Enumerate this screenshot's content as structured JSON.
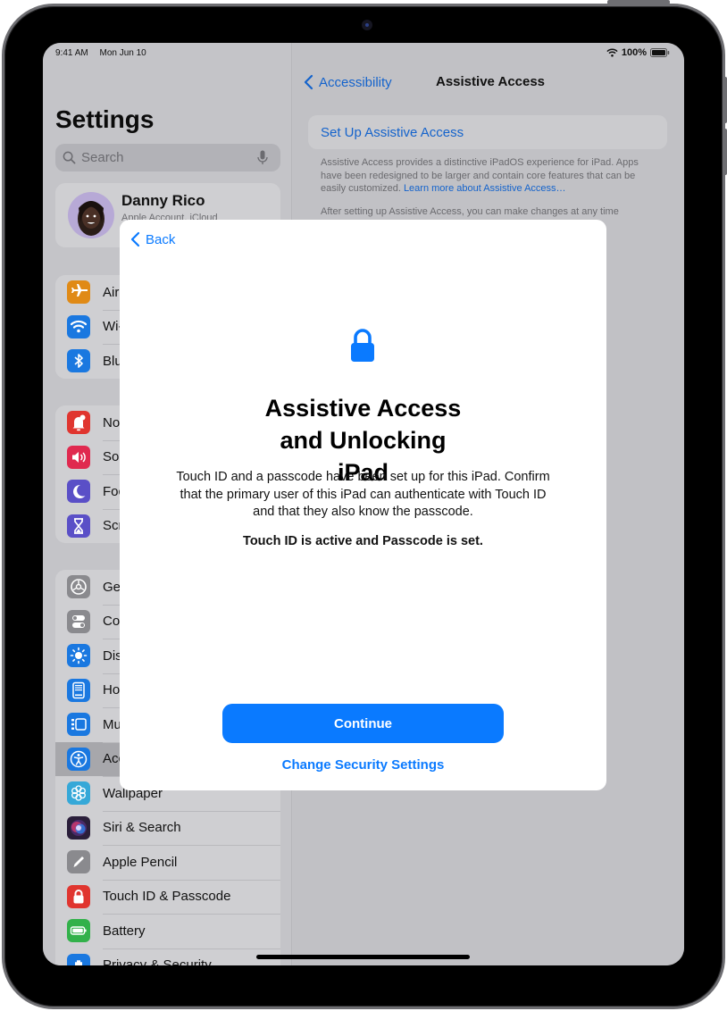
{
  "status_bar": {
    "time": "9:41 AM",
    "date": "Mon Jun 10",
    "battery": "100%"
  },
  "sidebar": {
    "title": "Settings",
    "search_placeholder": "Search",
    "profile": {
      "name": "Danny Rico",
      "subtitle": "Apple Account, iCloud"
    },
    "groups": [
      [
        {
          "label": "Airplane Mode",
          "icon": "airplane-icon",
          "color": "#e08a16"
        },
        {
          "label": "Wi-Fi",
          "icon": "wifi-icon",
          "color": "#1a78e0"
        },
        {
          "label": "Bluetooth",
          "icon": "bluetooth-icon",
          "color": "#1a78e0"
        }
      ],
      [
        {
          "label": "Notifications",
          "icon": "bell-icon",
          "color": "#e0352f"
        },
        {
          "label": "Sounds",
          "icon": "speaker-icon",
          "color": "#e0294f"
        },
        {
          "label": "Focus",
          "icon": "moon-icon",
          "color": "#5a4fc7"
        },
        {
          "label": "Screen Time",
          "icon": "hourglass-icon",
          "color": "#5a4fc7"
        }
      ],
      [
        {
          "label": "General",
          "icon": "gear-icon",
          "color": "#8a8a8e"
        },
        {
          "label": "Control Center",
          "icon": "toggles-icon",
          "color": "#8a8a8e"
        },
        {
          "label": "Display & Brightness",
          "icon": "sun-icon",
          "color": "#1a78e0"
        },
        {
          "label": "Home Screen & App Library",
          "icon": "home-screen-icon",
          "color": "#1a78e0"
        },
        {
          "label": "Multitasking & Gestures",
          "icon": "multitasking-icon",
          "color": "#1a78e0"
        },
        {
          "label": "Accessibility",
          "icon": "accessibility-icon",
          "color": "#1a78e0",
          "selected": true
        },
        {
          "label": "Wallpaper",
          "icon": "flower-icon",
          "color": "#35a8d8"
        },
        {
          "label": "Siri & Search",
          "icon": "siri-icon",
          "color": "#2a1e3a"
        },
        {
          "label": "Apple Pencil",
          "icon": "pencil-icon",
          "color": "#8a8a8e"
        },
        {
          "label": "Touch ID & Passcode",
          "icon": "lock-icon",
          "color": "#e0352f"
        },
        {
          "label": "Battery",
          "icon": "battery-icon",
          "color": "#32b14a"
        },
        {
          "label": "Privacy & Security",
          "icon": "hand-icon",
          "color": "#1a78e0"
        }
      ]
    ]
  },
  "detail": {
    "back_label": "Accessibility",
    "title": "Assistive Access",
    "setup_button": "Set Up Assistive Access",
    "description": "Assistive Access provides a distinctive iPadOS experience for iPad. Apps have been redesigned to be larger and contain core features that can be easily customized.",
    "learn_more": "Learn more about Assistive Access…",
    "description2": "After setting up Assistive Access, you can make changes at any time"
  },
  "modal": {
    "back_label": "Back",
    "title": "Assistive Access and Unlocking iPad",
    "body": "Touch ID and a passcode have been set up for this iPad. Confirm that the primary user of this iPad can authenticate with Touch ID and that they also know the passcode.",
    "status": "Touch ID is active and Passcode is set.",
    "continue_label": "Continue",
    "change_label": "Change Security Settings",
    "accent": "#0a7aff"
  }
}
